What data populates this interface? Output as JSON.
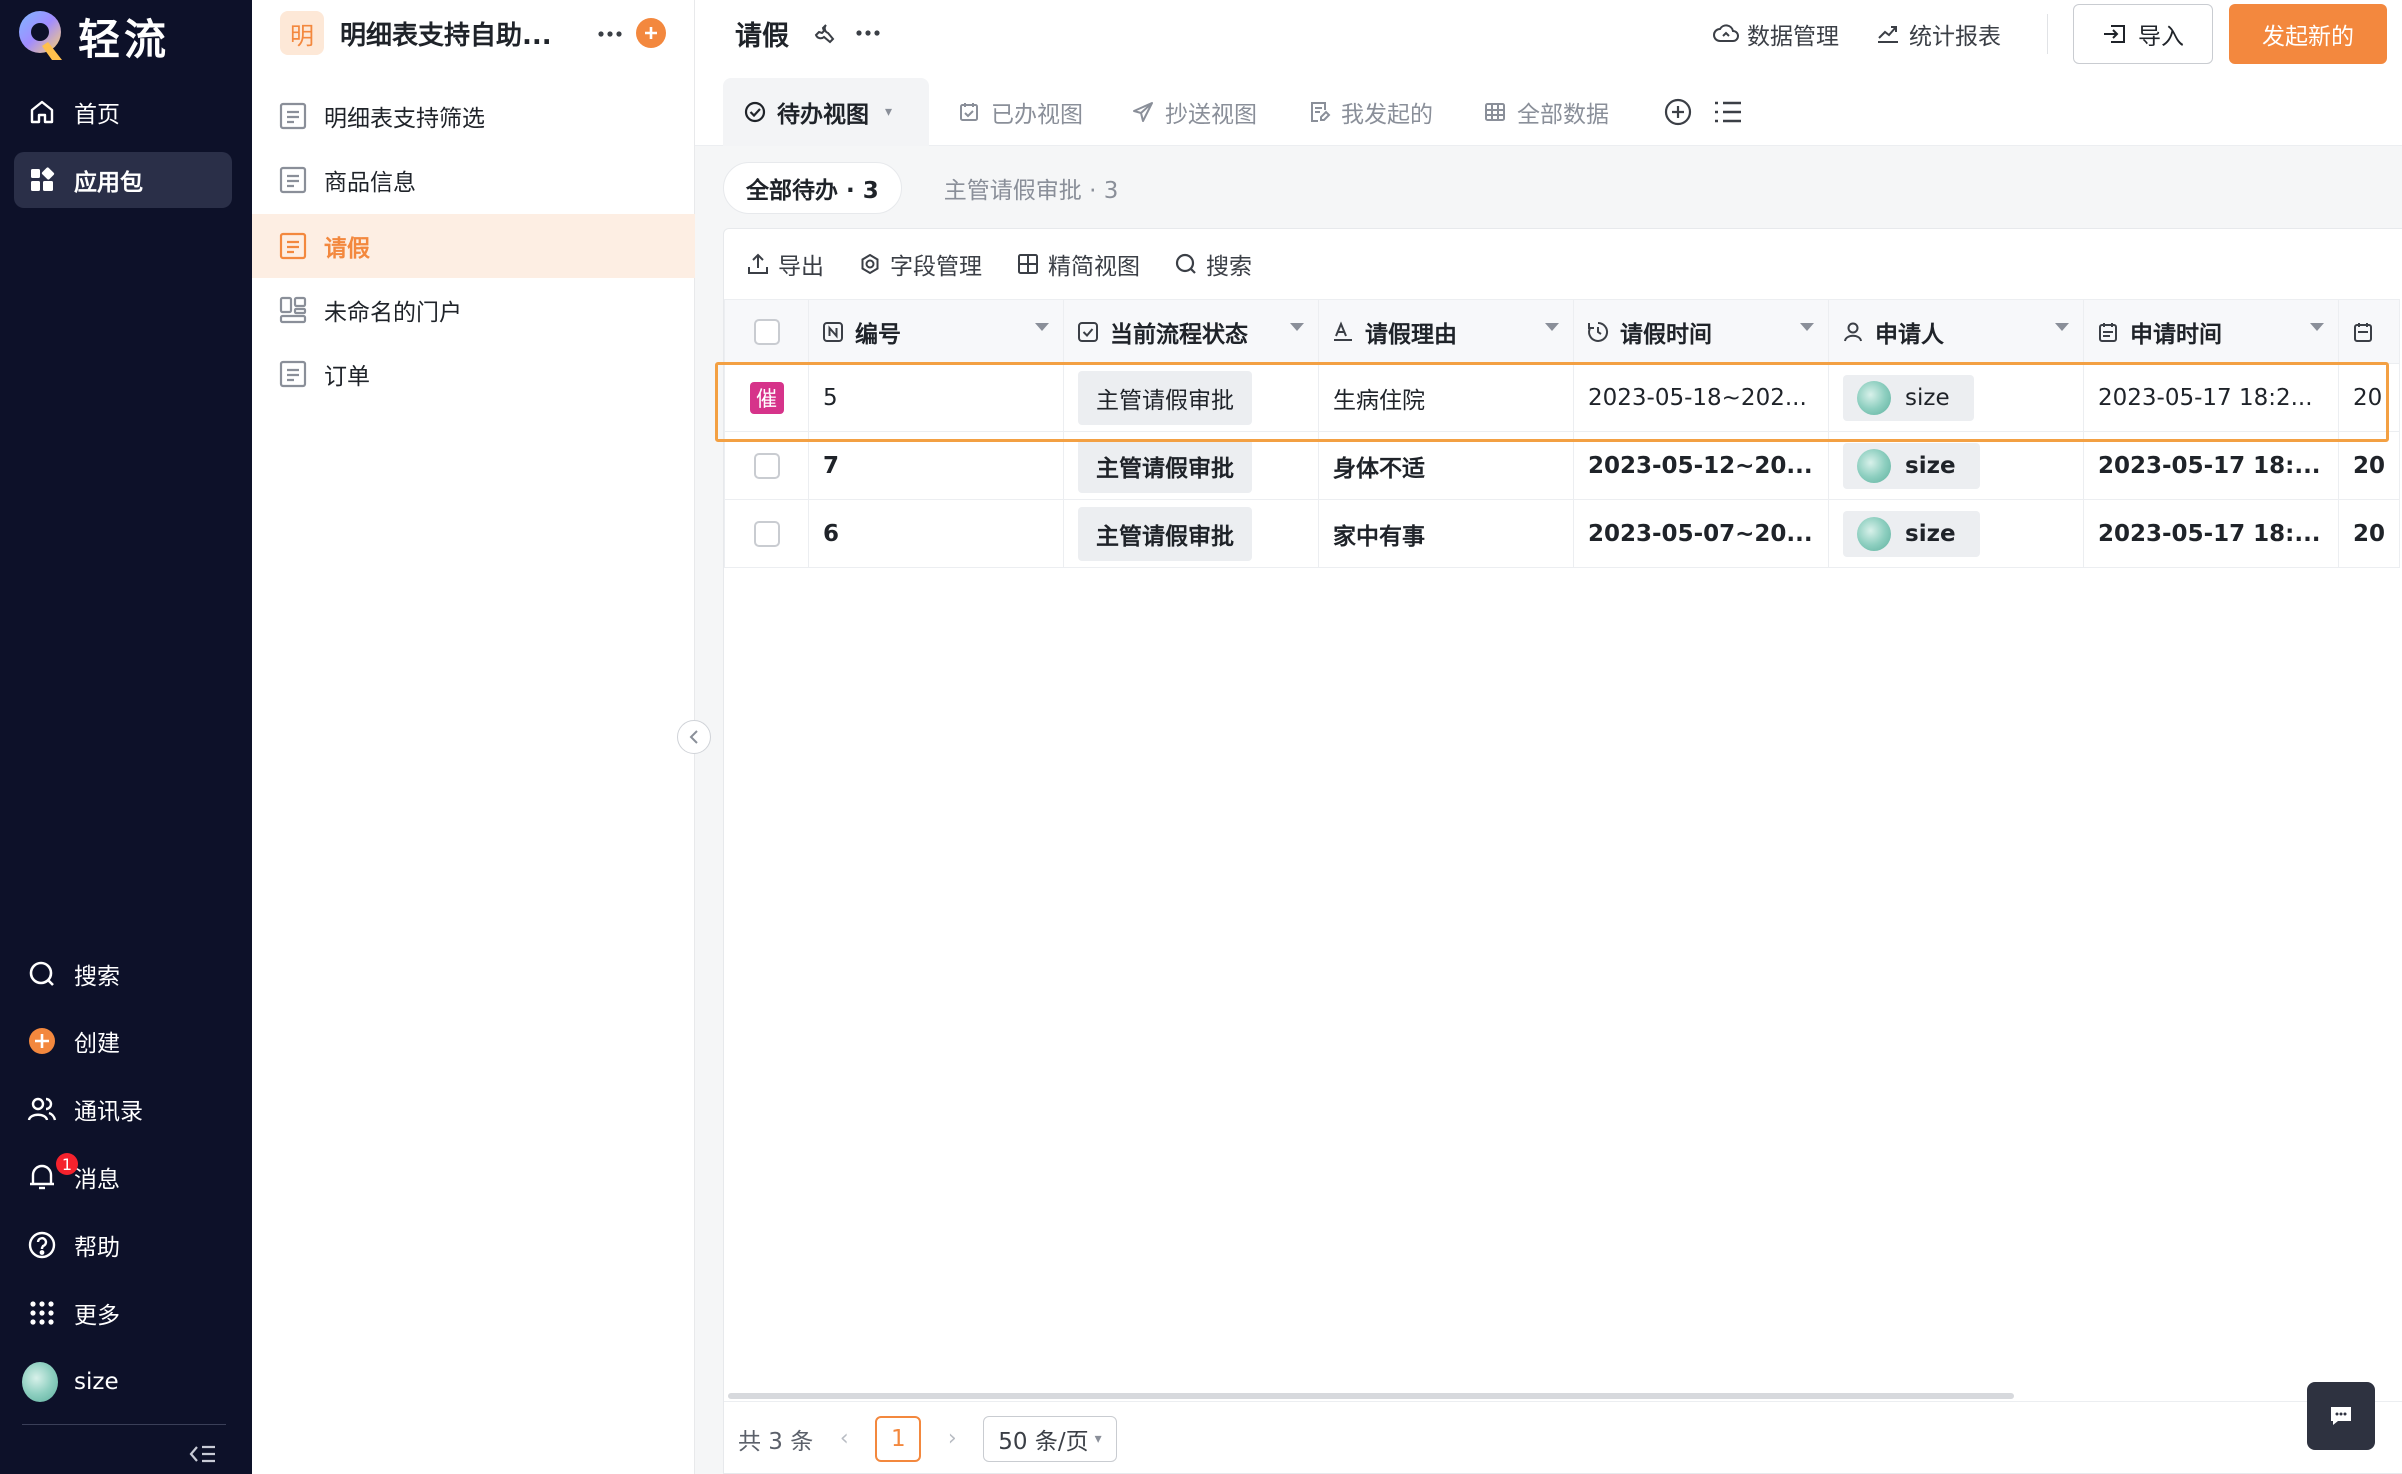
{
  "brand": {
    "name": "轻流",
    "accent": "#f3883e",
    "rail_bg": "#0d1129"
  },
  "rail": {
    "top_items": [
      {
        "label": "首页",
        "icon": "home-icon"
      },
      {
        "label": "应用包",
        "icon": "apps-icon",
        "active": true
      }
    ],
    "bottom_items": [
      {
        "label": "搜索",
        "icon": "search-icon"
      },
      {
        "label": "创建",
        "icon": "plus-circle-icon"
      },
      {
        "label": "通讯录",
        "icon": "contacts-icon"
      },
      {
        "label": "消息",
        "icon": "bell-icon",
        "badge": "1"
      },
      {
        "label": "帮助",
        "icon": "help-icon"
      },
      {
        "label": "更多",
        "icon": "grid-dots-icon"
      },
      {
        "label": "size",
        "icon": "user-avatar"
      }
    ]
  },
  "package": {
    "avatar_char": "明",
    "title": "明细表支持自助...",
    "items": [
      {
        "label": "明细表支持筛选",
        "icon": "form-icon"
      },
      {
        "label": "商品信息",
        "icon": "form-icon"
      },
      {
        "label": "请假",
        "icon": "form-icon",
        "active": true
      },
      {
        "label": "未命名的门户",
        "icon": "portal-icon"
      },
      {
        "label": "订单",
        "icon": "form-icon"
      }
    ]
  },
  "header": {
    "title": "请假",
    "data_manage": "数据管理",
    "stats_report": "统计报表",
    "import": "导入",
    "new_button": "发起新的"
  },
  "views": {
    "tabs": [
      {
        "label": "待办视图",
        "icon": "check-circle-icon",
        "active": true
      },
      {
        "label": "已办视图",
        "icon": "calendar-check-icon"
      },
      {
        "label": "抄送视图",
        "icon": "send-icon"
      },
      {
        "label": "我发起的",
        "icon": "doc-edit-icon"
      },
      {
        "label": "全部数据",
        "icon": "table-icon"
      }
    ]
  },
  "filters": [
    {
      "label": "全部待办 · 3",
      "active": true
    },
    {
      "label": "主管请假审批 · 3",
      "active": false
    }
  ],
  "toolbar": {
    "export": "导出",
    "fields": "字段管理",
    "compact": "精简视图",
    "search": "搜索"
  },
  "table": {
    "columns": [
      {
        "label": "编号",
        "icon": "number-icon"
      },
      {
        "label": "当前流程状态",
        "icon": "status-icon"
      },
      {
        "label": "请假理由",
        "icon": "text-icon"
      },
      {
        "label": "请假时间",
        "icon": "time-range-icon"
      },
      {
        "label": "申请人",
        "icon": "person-icon"
      },
      {
        "label": "申请时间",
        "icon": "date-icon"
      }
    ],
    "rows": [
      {
        "urge": "催",
        "id": "5",
        "status": "主管请假审批",
        "reason": "生病住院",
        "leave_time": "2023-05-18~202...",
        "applicant": "size",
        "apply_time": "2023-05-17 18:2...",
        "extra": "20",
        "bold": false
      },
      {
        "urge": "",
        "id": "7",
        "status": "主管请假审批",
        "reason": "身体不适",
        "leave_time": "2023-05-12~20...",
        "applicant": "size",
        "apply_time": "2023-05-17 18:...",
        "extra": "20",
        "bold": true
      },
      {
        "urge": "",
        "id": "6",
        "status": "主管请假审批",
        "reason": "家中有事",
        "leave_time": "2023-05-07~20...",
        "applicant": "size",
        "apply_time": "2023-05-17 18:...",
        "extra": "20",
        "bold": true
      }
    ]
  },
  "pager": {
    "total": "共 3 条",
    "current_page": "1",
    "page_size": "50 条/页"
  }
}
